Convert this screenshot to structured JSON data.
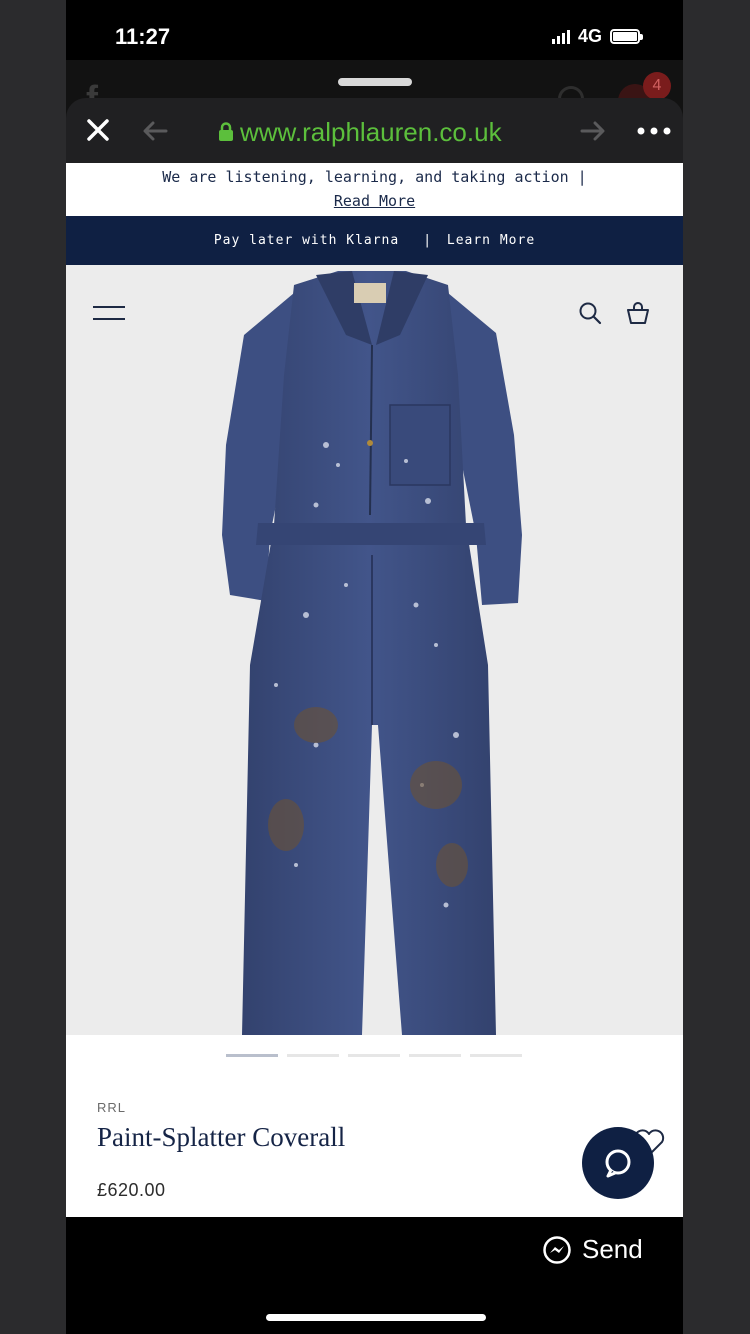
{
  "status_bar": {
    "time": "11:27",
    "network": "4G",
    "battery_level_percent": 100
  },
  "background_app": {
    "notification_count": "4"
  },
  "browser": {
    "url": "www.ralphlauren.co.uk",
    "icons": [
      "close-icon",
      "back-arrow-icon",
      "lock-icon",
      "forward-arrow-icon",
      "more-icon"
    ]
  },
  "notice": {
    "text": "We are listening, learning, and taking action |",
    "link": "Read More"
  },
  "promo": {
    "text": "Pay later with Klarna",
    "separator": "|",
    "link": "Learn More"
  },
  "header_icons": [
    "menu-icon",
    "search-icon",
    "shopping-bag-icon"
  ],
  "carousel": {
    "slides": 5,
    "active_index": 0
  },
  "product": {
    "brand": "RRL",
    "name": "Paint-Splatter Coverall",
    "price": "£620.00"
  },
  "share": {
    "label": "Send"
  },
  "colors": {
    "navy": "#0f2043",
    "url_green": "#5cbf3c",
    "coverall_blue": "#3b4d7f"
  }
}
